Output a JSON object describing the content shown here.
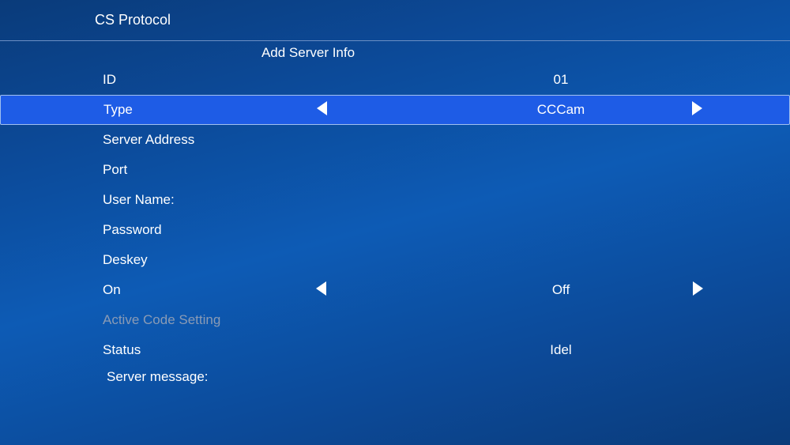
{
  "header": {
    "title": "CS Protocol"
  },
  "section_title": "Add Server Info",
  "rows": {
    "id": {
      "label": "ID",
      "value": "01"
    },
    "type": {
      "label": "Type",
      "value": "CCCam"
    },
    "server_address": {
      "label": "Server Address",
      "value": ""
    },
    "port": {
      "label": "Port",
      "value": ""
    },
    "user_name": {
      "label": "User Name:",
      "value": ""
    },
    "password": {
      "label": "Password",
      "value": ""
    },
    "deskey": {
      "label": "Deskey",
      "value": ""
    },
    "on": {
      "label": "On",
      "value": "Off"
    },
    "active_code": {
      "label": "Active Code Setting",
      "value": ""
    },
    "status": {
      "label": "Status",
      "value": "Idel"
    },
    "server_message": {
      "label": "Server message:",
      "value": ""
    }
  }
}
